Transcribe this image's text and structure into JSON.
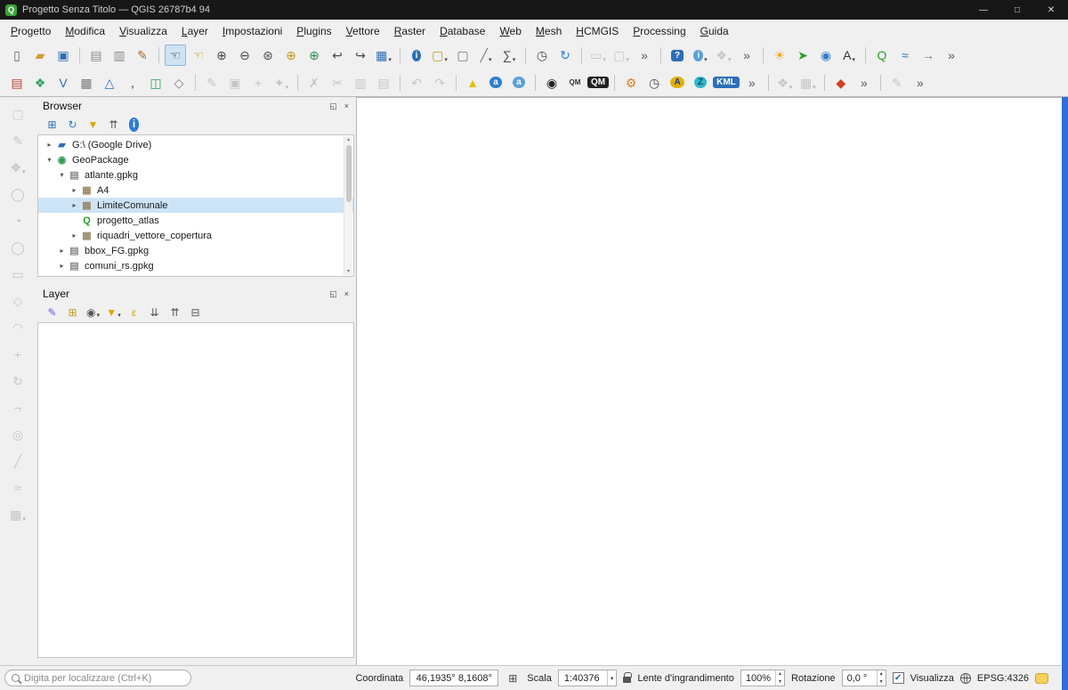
{
  "window": {
    "title": "Progetto Senza Titolo — QGIS 26787b4 94",
    "logo_glyph": "Q",
    "controls": {
      "minimize": "—",
      "maximize": "□",
      "close": "✕"
    }
  },
  "menubar": {
    "items": [
      {
        "name": "menu-progetto",
        "label": "Progetto"
      },
      {
        "name": "menu-modifica",
        "label": "Modifica"
      },
      {
        "name": "menu-visualizza",
        "label": "Visualizza"
      },
      {
        "name": "menu-layer",
        "label": "Layer"
      },
      {
        "name": "menu-impostazioni",
        "label": "Impostazioni"
      },
      {
        "name": "menu-plugins",
        "label": "Plugins"
      },
      {
        "name": "menu-vettore",
        "label": "Vettore"
      },
      {
        "name": "menu-raster",
        "label": "Raster"
      },
      {
        "name": "menu-database",
        "label": "Database"
      },
      {
        "name": "menu-web",
        "label": "Web"
      },
      {
        "name": "menu-mesh",
        "label": "Mesh"
      },
      {
        "name": "menu-hcmgis",
        "label": "HCMGIS"
      },
      {
        "name": "menu-processing",
        "label": "Processing"
      },
      {
        "name": "menu-guida",
        "label": "Guida"
      }
    ]
  },
  "toolbar_row1": {
    "icons": [
      {
        "name": "new-project",
        "glyph": "▯",
        "color": "#666666"
      },
      {
        "name": "open-project",
        "glyph": "▰",
        "color": "#d79b32"
      },
      {
        "name": "save-project",
        "glyph": "▣",
        "color": "#2e6fb7"
      },
      {
        "name": "new-print-layout",
        "glyph": "▤",
        "color": "#8a8a8a",
        "sep_before": true
      },
      {
        "name": "show-layout-manager",
        "glyph": "▥",
        "color": "#8a8a8a"
      },
      {
        "name": "style-manager",
        "glyph": "✎",
        "color": "#a66a2e"
      },
      {
        "name": "pan-map",
        "glyph": "☜",
        "color": "#333333",
        "active": true,
        "sep_before": true
      },
      {
        "name": "pan-to-selection",
        "glyph": "☜",
        "color": "#c49a17"
      },
      {
        "name": "zoom-in",
        "glyph": "⊕",
        "color": "#4a4a4a"
      },
      {
        "name": "zoom-out",
        "glyph": "⊖",
        "color": "#4a4a4a"
      },
      {
        "name": "zoom-full-extent",
        "glyph": "⊛",
        "color": "#4a4a4a"
      },
      {
        "name": "zoom-to-selection",
        "glyph": "⊕",
        "color": "#c49a17"
      },
      {
        "name": "zoom-to-layer",
        "glyph": "⊕",
        "color": "#2e8b57"
      },
      {
        "name": "zoom-last",
        "glyph": "↩",
        "color": "#4a4a4a"
      },
      {
        "name": "zoom-next",
        "glyph": "↪",
        "color": "#4a4a4a"
      },
      {
        "name": "new-map-view",
        "glyph": "▦",
        "color": "#2e6fb7",
        "dropdown": true
      },
      {
        "name": "identify-features",
        "glyph": "i",
        "bg": "#2e6fb7",
        "round": true,
        "color": "#ffffff",
        "sep_before": true
      },
      {
        "name": "select-features",
        "glyph": "▢",
        "color": "#c49a17",
        "dropdown": true
      },
      {
        "name": "deselect-features",
        "glyph": "▢",
        "color": "#777777"
      },
      {
        "name": "measure",
        "glyph": "╱",
        "color": "#777777",
        "dropdown": true
      },
      {
        "name": "statistical-summary",
        "glyph": "∑",
        "color": "#4a4a4a",
        "dropdown": true
      },
      {
        "name": "temporal-controller-panel",
        "glyph": "◷",
        "color": "#4a4a4a",
        "sep_before": true
      },
      {
        "name": "refresh-map",
        "glyph": "↻",
        "color": "#2e7dd1"
      },
      {
        "name": "selection-tool-a",
        "glyph": "▭",
        "color": "#777777",
        "disabled": true,
        "dropdown": true,
        "sep_before": true
      },
      {
        "name": "selection-tool-b",
        "glyph": "▢",
        "color": "#777777",
        "disabled": true,
        "dropdown": true
      },
      {
        "name": "toolbar-overflow-1",
        "glyph": "»",
        "color": "#555555"
      },
      {
        "name": "help",
        "glyph": "?",
        "bg": "#2e6fb7",
        "color": "#ffffff",
        "sep_before": true
      },
      {
        "name": "whats-this",
        "glyph": "i",
        "bg": "#5aa0d8",
        "round": true,
        "color": "#ffffff",
        "dropdown": true
      },
      {
        "name": "plugin-disabled-a",
        "glyph": "❖",
        "color": "#777777",
        "disabled": true,
        "dropdown": true
      },
      {
        "name": "toolbar-overflow-2",
        "glyph": "»",
        "color": "#555555"
      },
      {
        "name": "options-star-plugin",
        "glyph": "☀",
        "color": "#f0a30a",
        "sep_before": true
      },
      {
        "name": "share-plugin",
        "glyph": "➤",
        "color": "#2ca02c"
      },
      {
        "name": "metasearch",
        "glyph": "◉",
        "color": "#2e7dd1"
      },
      {
        "name": "translate-plugin",
        "glyph": "A",
        "color": "#333333",
        "dropdown": true
      },
      {
        "name": "quickmap-search",
        "glyph": "Q",
        "color": "#2ca02c",
        "sep_before": true
      },
      {
        "name": "profile-plot",
        "glyph": "≈",
        "color": "#2e6fb7"
      },
      {
        "name": "export-page",
        "glyph": "→",
        "color": "#777777"
      },
      {
        "name": "toolbar-overflow-3",
        "glyph": "»",
        "color": "#555555"
      }
    ]
  },
  "toolbar_row2": {
    "icons": [
      {
        "name": "data-source-manager",
        "glyph": "▤",
        "color": "#b5442c"
      },
      {
        "name": "add-geopackage-layer",
        "glyph": "❖",
        "color": "#2ca05a"
      },
      {
        "name": "add-vector-layer",
        "glyph": "V",
        "color": "#2e6fb7"
      },
      {
        "name": "add-raster-layer",
        "glyph": "▦",
        "color": "#777777"
      },
      {
        "name": "add-mesh-layer",
        "glyph": "△",
        "color": "#2e6fb7"
      },
      {
        "name": "add-delimited-text-layer",
        "glyph": ",",
        "color": "#333333"
      },
      {
        "name": "add-postgis-layer",
        "glyph": "◫",
        "color": "#2ca05a"
      },
      {
        "name": "add-virtual-layer",
        "glyph": "◇",
        "color": "#777777"
      },
      {
        "name": "toggle-editing",
        "glyph": "✎",
        "color": "#777777",
        "disabled": true,
        "sep_before": true
      },
      {
        "name": "save-layer-edits",
        "glyph": "▣",
        "color": "#777777",
        "disabled": true
      },
      {
        "name": "add-feature",
        "glyph": "+",
        "color": "#777777",
        "disabled": true
      },
      {
        "name": "vertex-tool",
        "glyph": "✦",
        "color": "#777777",
        "disabled": true,
        "dropdown": true
      },
      {
        "name": "delete-selected",
        "glyph": "✗",
        "color": "#777777",
        "disabled": true,
        "sep_before": true
      },
      {
        "name": "cut-features",
        "glyph": "✂",
        "color": "#777777",
        "disabled": true
      },
      {
        "name": "copy-features",
        "glyph": "▥",
        "color": "#777777",
        "disabled": true
      },
      {
        "name": "paste-features",
        "glyph": "▤",
        "color": "#777777",
        "disabled": true
      },
      {
        "name": "undo",
        "glyph": "↶",
        "color": "#777777",
        "disabled": true,
        "sep_before": true
      },
      {
        "name": "redo",
        "glyph": "↷",
        "color": "#777777",
        "disabled": true
      },
      {
        "name": "layer-labeling-options",
        "glyph": "▲",
        "color": "#e3c000",
        "sep_before": true
      },
      {
        "name": "label-tool-pin",
        "glyph": "a",
        "bg": "#2e7dd1",
        "round": true,
        "color": "#ffffff"
      },
      {
        "name": "label-tool-move",
        "glyph": "a",
        "bg": "#5aa0d8",
        "round": true,
        "color": "#ffffff"
      },
      {
        "name": "osm-place-search",
        "glyph": "◉",
        "color": "#222222",
        "sep_before": true
      },
      {
        "name": "qmetatiles",
        "glyph": "QM",
        "color": "#333333"
      },
      {
        "name": "qtiles",
        "glyph": "QM",
        "bg": "#222222",
        "color": "#ffffff"
      },
      {
        "name": "plugin-tool-orange",
        "glyph": "⚙",
        "color": "#e07b20",
        "sep_before": true
      },
      {
        "name": "time-manager",
        "glyph": "◷",
        "color": "#4a4a4a"
      },
      {
        "name": "plugin-badge-a",
        "glyph": "A",
        "bg": "#e3b000",
        "round": true,
        "color": "#1a3c8c"
      },
      {
        "name": "plugin-badge-z",
        "glyph": "Z",
        "bg": "#30b8c8",
        "round": true,
        "color": "#13406a"
      },
      {
        "name": "kml-tools",
        "glyph": "KML",
        "bg": "#2e6fb7",
        "color": "#ffffff"
      },
      {
        "name": "toolbar2-overflow-1",
        "glyph": "»",
        "color": "#555555"
      },
      {
        "name": "plugin-disabled-b",
        "glyph": "❖",
        "color": "#777777",
        "disabled": true,
        "dropdown": true,
        "sep_before": true
      },
      {
        "name": "plugin-disabled-c",
        "glyph": "▦",
        "color": "#777777",
        "disabled": true,
        "dropdown": true
      },
      {
        "name": "saga-plugin",
        "glyph": "◆",
        "color": "#d2401e",
        "sep_before": true
      },
      {
        "name": "toolbar2-overflow-2",
        "glyph": "»",
        "color": "#555555"
      },
      {
        "name": "edit-disabled-plugin",
        "glyph": "✎",
        "color": "#777777",
        "disabled": true,
        "sep_before": true
      },
      {
        "name": "toolbar2-overflow-3",
        "glyph": "»",
        "color": "#555555"
      }
    ]
  },
  "left_toolbar": {
    "icons": [
      {
        "name": "left-select-tool",
        "glyph": "▢",
        "color": "#8a8a8a",
        "disabled": true
      },
      {
        "name": "digitize-pencil",
        "glyph": "✎",
        "color": "#a06a5a",
        "disabled": true
      },
      {
        "name": "digitize-shape-menu",
        "glyph": "❖",
        "color": "#a06a5a",
        "disabled": true,
        "dropdown": true
      },
      {
        "name": "digitize-circle-2pt",
        "glyph": "◯",
        "color": "#a06a5a",
        "disabled": true
      },
      {
        "name": "digitize-circle-3pt",
        "glyph": "◔",
        "color": "#a06a5a",
        "disabled": true
      },
      {
        "name": "digitize-ellipse",
        "glyph": "◯",
        "color": "#a06a5a",
        "disabled": true
      },
      {
        "name": "digitize-rectangle",
        "glyph": "▭",
        "color": "#a06a5a",
        "disabled": true
      },
      {
        "name": "digitize-polygon",
        "glyph": "◇",
        "color": "#a06a5a",
        "disabled": true
      },
      {
        "name": "digitize-curve",
        "glyph": "◠",
        "color": "#a06a5a",
        "disabled": true
      },
      {
        "name": "digitize-move-feature",
        "glyph": "+",
        "color": "#a06a5a",
        "disabled": true
      },
      {
        "name": "digitize-rotate-feature",
        "glyph": "↻",
        "color": "#a06a5a",
        "disabled": true
      },
      {
        "name": "digitize-trim-extend",
        "glyph": "¬",
        "color": "#a06a5a",
        "disabled": true
      },
      {
        "name": "digitize-fill-ring",
        "glyph": "◎",
        "color": "#a06a5a",
        "disabled": true
      },
      {
        "name": "digitize-split-features",
        "glyph": "╱",
        "color": "#a06a5a",
        "disabled": true
      },
      {
        "name": "digitize-reshape",
        "glyph": "≈",
        "color": "#a06a5a",
        "disabled": true
      },
      {
        "name": "digitize-more-tools",
        "glyph": "▦",
        "color": "#a06a5a",
        "disabled": true,
        "dropdown": true
      }
    ]
  },
  "browser_panel": {
    "title": "Browser",
    "toolbar": [
      {
        "name": "add-selected-layers",
        "glyph": "⊞",
        "color": "#2e6fb7"
      },
      {
        "name": "refresh-browser",
        "glyph": "↻",
        "color": "#2e7dd1"
      },
      {
        "name": "filter-browser",
        "glyph": "▼",
        "color": "#d8a800"
      },
      {
        "name": "collapse-all",
        "glyph": "⇈",
        "color": "#555555"
      },
      {
        "name": "properties-widget",
        "glyph": "i",
        "bg": "#2e7dd1",
        "round": true,
        "color": "#ffffff"
      }
    ],
    "tree": [
      {
        "name": "tree-item-google-drive",
        "indent": 0,
        "expander": "▸",
        "icon_name": "drive-folder-icon",
        "icon_glyph": "▰",
        "icon_color": "#2e6fb7",
        "label": "G:\\ (Google Drive)"
      },
      {
        "name": "tree-item-geopackage",
        "indent": 0,
        "expander": "▾",
        "icon_name": "geopackage-icon",
        "icon_glyph": "◉",
        "icon_color": "#2a9d4f",
        "label": "GeoPackage"
      },
      {
        "name": "tree-item-atlante-gpkg",
        "indent": 1,
        "expander": "▾",
        "icon_name": "gpkg-database-icon",
        "icon_glyph": "▤",
        "icon_color": "#8a8a8a",
        "label": "atlante.gpkg"
      },
      {
        "name": "tree-item-a4",
        "indent": 2,
        "expander": "▸",
        "icon_name": "layer-group-icon",
        "icon_glyph": "▦",
        "icon_color": "#9a8a6a",
        "label": "A4"
      },
      {
        "name": "tree-item-limitecomunale",
        "indent": 2,
        "expander": "▸",
        "icon_name": "layer-group-icon",
        "icon_glyph": "▦",
        "icon_color": "#9a8a6a",
        "label": "LimiteComunale",
        "selected": true
      },
      {
        "name": "tree-item-progetto-atlas",
        "indent": 2,
        "expander": "",
        "icon_name": "qgis-project-icon",
        "icon_glyph": "Q",
        "icon_color": "#2ca02c",
        "label": "progetto_atlas"
      },
      {
        "name": "tree-item-riquadri-vettore-copertura",
        "indent": 2,
        "expander": "▸",
        "icon_name": "layer-group-icon",
        "icon_glyph": "▦",
        "icon_color": "#9a8a6a",
        "label": "riquadri_vettore_copertura"
      },
      {
        "name": "tree-item-bbox-fg-gpkg",
        "indent": 1,
        "expander": "▸",
        "icon_name": "gpkg-database-icon",
        "icon_glyph": "▤",
        "icon_color": "#8a8a8a",
        "label": "bbox_FG.gpkg"
      },
      {
        "name": "tree-item-comuni-rs-gpkg",
        "indent": 1,
        "expander": "▸",
        "icon_name": "gpkg-database-icon",
        "icon_glyph": "▤",
        "icon_color": "#8a8a8a",
        "label": "comuni_rs.gpkg"
      }
    ]
  },
  "layer_panel": {
    "title": "Layer",
    "toolbar": [
      {
        "name": "open-layer-styling",
        "glyph": "✎",
        "color": "#7a4fd0"
      },
      {
        "name": "add-group",
        "glyph": "⊞",
        "color": "#c49a17"
      },
      {
        "name": "manage-map-themes",
        "glyph": "◉",
        "color": "#555555",
        "dropdown": true
      },
      {
        "name": "filter-legend",
        "glyph": "▼",
        "color": "#d8a800",
        "dropdown": true
      },
      {
        "name": "filter-by-expression",
        "glyph": "ε",
        "color": "#d8a800"
      },
      {
        "name": "expand-all",
        "glyph": "⇊",
        "color": "#555555"
      },
      {
        "name": "collapse-all-layers",
        "glyph": "⇈",
        "color": "#555555"
      },
      {
        "name": "remove-layer-group",
        "glyph": "⊟",
        "color": "#555555"
      }
    ]
  },
  "statusbar": {
    "search_placeholder": "Digita per localizzare (Ctrl+K)",
    "coordinate_label": "Coordinata",
    "coordinate_value": "46,1935° 8,1608°",
    "extents_icon_glyph": "⊞",
    "scale_label": "Scala",
    "scale_value": "1:40376",
    "magnifier_label": "Lente d'ingrandimento",
    "magnifier_value": "100%",
    "rotation_label": "Rotazione",
    "rotation_value": "0,0 °",
    "render_label": "Visualizza",
    "render_checked": true,
    "check_glyph": "✓",
    "crs_label": "EPSG:4326"
  },
  "ui": {
    "dropdown_arrow_glyph": "▾",
    "chevron_down_glyph": "▾",
    "spin_up_glyph": "▴",
    "spin_down_glyph": "▾",
    "undock_glyph": "◱",
    "panel_close_glyph": "×",
    "scroll_up_glyph": "▴",
    "scroll_down_glyph": "▾"
  },
  "colors": {
    "titlebar_bg": "#171717",
    "chrome_bg": "#f0f0f0",
    "selection_bg": "#cde4f7",
    "accent_strip": "#2f6ed6"
  }
}
